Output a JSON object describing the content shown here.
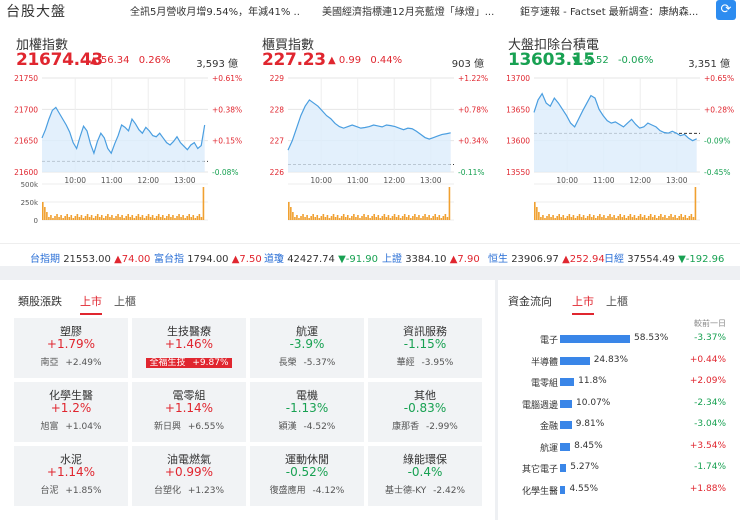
{
  "header": {
    "title": "台股大盤",
    "news": [
      "全訊5月營收月增9.54%，年減41% ...",
      "美國經濟指標連12月亮藍燈「綠燈」...",
      "鉅亨速報 - Factset 最新調查：康納森..."
    ],
    "refresh_icon": "refresh-icon"
  },
  "indices": [
    {
      "name": "加權指數",
      "price": "21674.43",
      "arrow": "▲",
      "change": "56.34",
      "pct": "0.26%",
      "volume": "3,593 億",
      "color": "#e0262f",
      "y_ticks": [
        "21750",
        "21700",
        "21650",
        "21600"
      ],
      "pct_ticks": [
        "+0.61%",
        "+0.38%",
        "+0.15%",
        "-0.08%"
      ],
      "vol_ticks": [
        "500k",
        "250k",
        "0"
      ],
      "x_ticks": [
        "10:00",
        "11:00",
        "12:00",
        "13:00"
      ],
      "chart_data": {
        "type": "line",
        "ylim": [
          21600,
          21760
        ],
        "prev_close": 21618.09,
        "values": [
          21658,
          21672,
          21690,
          21705,
          21710,
          21700,
          21690,
          21680,
          21668,
          21650,
          21640,
          21660,
          21678,
          21670,
          21648,
          21632,
          21652,
          21666,
          21658,
          21640,
          21632,
          21648,
          21662,
          21680,
          21676,
          21670,
          21690,
          21682,
          21672,
          21666,
          21676,
          21670,
          21662,
          21660,
          21666,
          21658,
          21650,
          21646,
          21652,
          21660,
          21650,
          21644,
          21638,
          21646,
          21650,
          21640,
          21645,
          21680
        ]
      }
    },
    {
      "name": "櫃買指數",
      "price": "227.23",
      "arrow": "▲",
      "change": "0.99",
      "pct": "0.44%",
      "volume": "903 億",
      "color": "#e0262f",
      "y_ticks": [
        "229",
        "228",
        "227",
        "226"
      ],
      "pct_ticks": [
        "+1.22%",
        "+0.78%",
        "+0.34%",
        "-0.11%"
      ],
      "vol_ticks": [
        "",
        "",
        ""
      ],
      "x_ticks": [
        "10:00",
        "11:00",
        "12:00",
        "13:00"
      ],
      "chart_data": {
        "type": "line",
        "ylim": [
          226,
          229
        ],
        "prev_close": 226.24,
        "values": [
          226.7,
          227.0,
          227.4,
          227.8,
          228.1,
          228.3,
          228.2,
          228.1,
          227.95,
          227.8,
          227.7,
          227.55,
          227.45,
          227.4,
          227.45,
          227.5,
          227.45,
          227.4,
          227.42,
          227.45,
          227.5,
          227.47,
          227.44,
          227.5,
          227.48,
          227.45,
          227.4,
          227.35,
          227.4,
          227.38,
          227.3,
          227.2,
          227.1,
          227.05,
          227.1,
          227.15,
          227.2,
          227.22,
          227.25
        ]
      }
    },
    {
      "name": "大盤扣除台積電",
      "price": "13603.15",
      "arrow": "▼",
      "change": "-8.52",
      "pct": "-0.06%",
      "volume": "3,351 億",
      "color": "#18a152",
      "y_ticks": [
        "13700",
        "13650",
        "13600",
        "13550"
      ],
      "pct_ticks": [
        "+0.65%",
        "+0.28%",
        "-0.09%",
        "-0.45%"
      ],
      "vol_ticks": [
        "",
        "",
        ""
      ],
      "x_ticks": [
        "10:00",
        "11:00",
        "12:00",
        "13:00"
      ],
      "chart_data": {
        "type": "line",
        "ylim": [
          13550,
          13700
        ],
        "prev_close": 13611.67,
        "values": [
          13645,
          13665,
          13675,
          13660,
          13655,
          13668,
          13660,
          13650,
          13640,
          13628,
          13622,
          13635,
          13648,
          13660,
          13672,
          13668,
          13650,
          13640,
          13632,
          13628,
          13630,
          13626,
          13622,
          13628,
          13634,
          13626,
          13620,
          13622,
          13628,
          13625,
          13622,
          13616,
          13613,
          13612,
          13615,
          13612,
          13608,
          13610,
          13604,
          13600,
          13603
        ]
      }
    }
  ],
  "ticker": [
    {
      "name": "台指期",
      "value": "21553.00",
      "change": "▲74.00",
      "up": true
    },
    {
      "name": "富台指",
      "value": "1794.00",
      "change": "▲7.50",
      "up": true
    },
    {
      "name": "道瓊",
      "value": "42427.74",
      "change": "▼-91.90",
      "up": false
    },
    {
      "name": "上證",
      "value": "3384.10",
      "change": "▲7.90",
      "up": true
    },
    {
      "name": "恒生",
      "value": "23906.97",
      "change": "▲252.94",
      "up": true
    },
    {
      "name": "日經",
      "value": "37554.49",
      "change": "▼-192.96",
      "up": false
    }
  ],
  "sectors": {
    "label": "類股漲跌",
    "tabs": [
      "上市",
      "上櫃"
    ],
    "items": [
      {
        "name": "塑膠",
        "pct": "+1.79%",
        "stock": "南亞",
        "stock_pct": "+2.49%",
        "up": true
      },
      {
        "name": "生技醫療",
        "pct": "+1.46%",
        "stock": "全福生技",
        "stock_pct": "+9.87%",
        "up": true,
        "highlight": true
      },
      {
        "name": "航運",
        "pct": "-3.9%",
        "stock": "長榮",
        "stock_pct": "-5.37%",
        "up": false
      },
      {
        "name": "資訊服務",
        "pct": "-1.15%",
        "stock": "華經",
        "stock_pct": "-3.95%",
        "up": false
      },
      {
        "name": "化學生醫",
        "pct": "+1.2%",
        "stock": "旭富",
        "stock_pct": "+1.04%",
        "up": true
      },
      {
        "name": "電零組",
        "pct": "+1.14%",
        "stock": "新日興",
        "stock_pct": "+6.55%",
        "up": true
      },
      {
        "name": "電機",
        "pct": "-1.13%",
        "stock": "穎漢",
        "stock_pct": "-4.52%",
        "up": false
      },
      {
        "name": "其他",
        "pct": "-0.83%",
        "stock": "康那香",
        "stock_pct": "-2.99%",
        "up": false
      },
      {
        "name": "水泥",
        "pct": "+1.14%",
        "stock": "台泥",
        "stock_pct": "+1.85%",
        "up": true
      },
      {
        "name": "油電燃氣",
        "pct": "+0.99%",
        "stock": "台塑化",
        "stock_pct": "+1.23%",
        "up": true
      },
      {
        "name": "運動休閒",
        "pct": "-0.52%",
        "stock": "復盛應用",
        "stock_pct": "-4.12%",
        "up": false
      },
      {
        "name": "綠能環保",
        "pct": "-0.4%",
        "stock": "基士德-KY",
        "stock_pct": "-2.42%",
        "up": false
      }
    ]
  },
  "fund_flow": {
    "label": "資金流向",
    "tabs": [
      "上市",
      "上櫃"
    ],
    "compare_label": "較前一日",
    "chart_data": {
      "type": "bar",
      "categories": [
        "電子",
        "半導體",
        "電零組",
        "電腦週邊",
        "金融",
        "航運",
        "其它電子",
        "化學生醫"
      ],
      "values": [
        58.53,
        24.83,
        11.8,
        10.07,
        9.81,
        8.45,
        5.27,
        4.55
      ],
      "labels": [
        "58.53%",
        "24.83%",
        "11.8%",
        "10.07%",
        "9.81%",
        "8.45%",
        "5.27%",
        "4.55%"
      ],
      "diff": [
        "-3.37%",
        "+0.44%",
        "+2.09%",
        "-2.34%",
        "-3.04%",
        "+3.54%",
        "-1.74%",
        "+1.88%"
      ]
    }
  }
}
